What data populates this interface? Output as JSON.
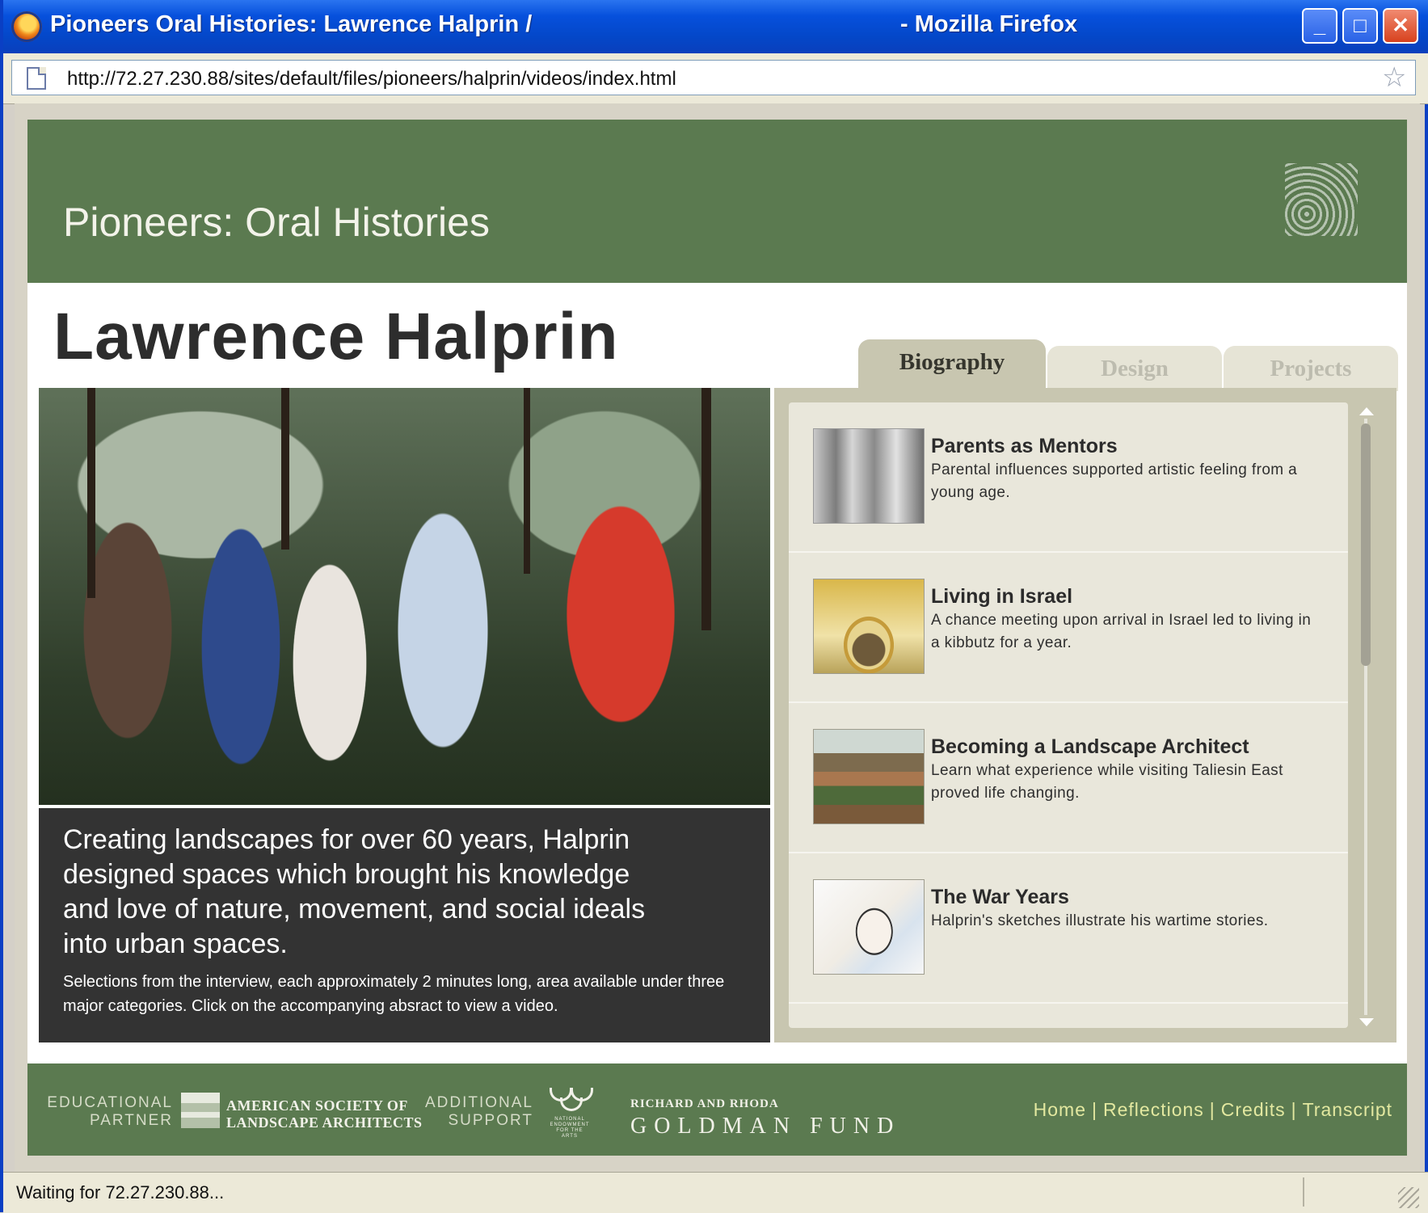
{
  "window": {
    "title": "Pioneers Oral Histories: Lawrence Halprin /",
    "title_suffix": "- Mozilla Firefox",
    "controls": {
      "minimize": "_",
      "maximize": "□",
      "close": "✕"
    }
  },
  "addressbar": {
    "url": "http://72.27.230.88/sites/default/files/pioneers/halprin/videos/index.html",
    "bookmark_star": "☆"
  },
  "header": {
    "site_title": "Pioneers: Oral Histories",
    "person_name": "Lawrence Halprin"
  },
  "caption": {
    "main": "Creating landscapes for over 60 years, Halprin designed spaces which brought his knowledge and love of nature, movement, and social ideals into urban spaces.",
    "sub": "Selections from the interview, each approximately 2 minutes long, area available under three major categories. Click on the accompanying absract to view a video."
  },
  "tabs": [
    {
      "label": "Biography",
      "active": true
    },
    {
      "label": "Design",
      "active": false
    },
    {
      "label": "Projects",
      "active": false
    }
  ],
  "biography_items": [
    {
      "title": "Parents as Mentors",
      "description": "Parental influences supported artistic feeling from a young age."
    },
    {
      "title": "Living in Israel",
      "description": "A chance meeting upon arrival in Israel led to living in a kibbutz for a year."
    },
    {
      "title": "Becoming a Landscape Architect",
      "description": "Learn what experience while visiting Taliesin East proved life changing."
    },
    {
      "title": "The War Years",
      "description": "Halprin's sketches illustrate his wartime stories."
    }
  ],
  "footer": {
    "educational_partner_label_1": "EDUCATIONAL",
    "educational_partner_label_2": "PARTNER",
    "asla_line1": "AMERICAN SOCIETY OF",
    "asla_line2": "LANDSCAPE ARCHITECTS",
    "additional_support_label_1": "ADDITIONAL",
    "additional_support_label_2": "SUPPORT",
    "nea_text": "NATIONAL ENDOWMENT FOR THE ARTS",
    "goldman_line1": "RICHARD AND RHODA",
    "goldman_line2": "GOLDMAN   FUND",
    "nav": [
      "Home",
      "Reflections",
      "Credits",
      "Transcript"
    ],
    "nav_separator": "|"
  },
  "statusbar": {
    "text": "Waiting for 72.27.230.88..."
  },
  "colors": {
    "header_green": "#5b7a50",
    "caption_bg": "#333333",
    "panel_bg": "#c8c6b0",
    "item_bg": "#e9e7db",
    "nav_link": "#e3e8a0"
  }
}
